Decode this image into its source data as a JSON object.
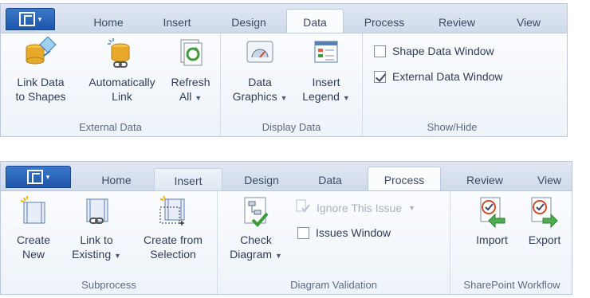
{
  "file_tab": "▾",
  "ribbon1": {
    "tabs": [
      "Home",
      "Insert",
      "Design",
      "Data",
      "Process",
      "Review",
      "View"
    ],
    "active_tab": "Data",
    "groups": {
      "external_data": {
        "label": "External Data",
        "link_shapes": [
          "Link Data",
          "to Shapes"
        ],
        "auto_link": [
          "Automatically",
          "Link"
        ],
        "refresh": [
          "Refresh",
          "All"
        ]
      },
      "display_data": {
        "label": "Display Data",
        "data_graphics": [
          "Data",
          "Graphics"
        ],
        "insert_legend": [
          "Insert",
          "Legend"
        ]
      },
      "show_hide": {
        "label": "Show/Hide",
        "shape_data_window": "Shape Data Window",
        "shape_data_checked": false,
        "external_data_window": "External Data Window",
        "external_data_checked": true
      }
    }
  },
  "ribbon2": {
    "tabs": [
      "Home",
      "Insert",
      "Design",
      "Data",
      "Process",
      "Review",
      "View"
    ],
    "active_tab": "Process",
    "hover_tab": "Insert",
    "groups": {
      "subprocess": {
        "label": "Subprocess",
        "create_new": [
          "Create",
          "New"
        ],
        "link_existing": [
          "Link to",
          "Existing"
        ],
        "create_selection": [
          "Create from",
          "Selection"
        ]
      },
      "diagram_validation": {
        "label": "Diagram Validation",
        "check_diagram": [
          "Check",
          "Diagram"
        ],
        "ignore_issue": "Ignore This Issue",
        "issues_window": "Issues Window",
        "issues_checked": false
      },
      "sharepoint": {
        "label": "SharePoint Workflow",
        "import": "Import",
        "export": "Export"
      }
    }
  },
  "colors": {
    "accent": "#1e55a8",
    "tab_bg": "#cfdaea",
    "body_bg": "#f3f6fb",
    "text": "#2f3e58"
  }
}
